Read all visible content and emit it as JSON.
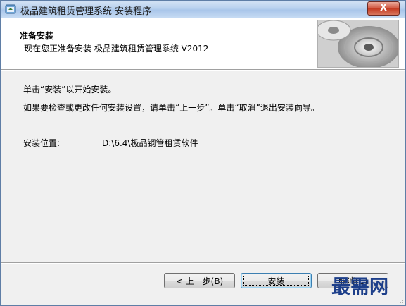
{
  "window": {
    "title": "极品建筑租赁管理系统 安装程序",
    "close_glyph": "X"
  },
  "header": {
    "title": "准备安装",
    "subtitle": "现在您正准备安装 极品建筑租赁管理系统 V2012"
  },
  "body": {
    "line1": "单击“安装”以开始安装。",
    "line2": "如果要检查或更改任何安装设置，请单击“上一步”。单击“取消”退出安装向导。",
    "install_location_label": "安装位置:",
    "install_location_value": "D:\\6.4\\极品钢管租赁软件"
  },
  "buttons": {
    "back": "< 上一步(B)",
    "install": "安装",
    "cancel": "取消(C)"
  },
  "watermark": "最需网"
}
